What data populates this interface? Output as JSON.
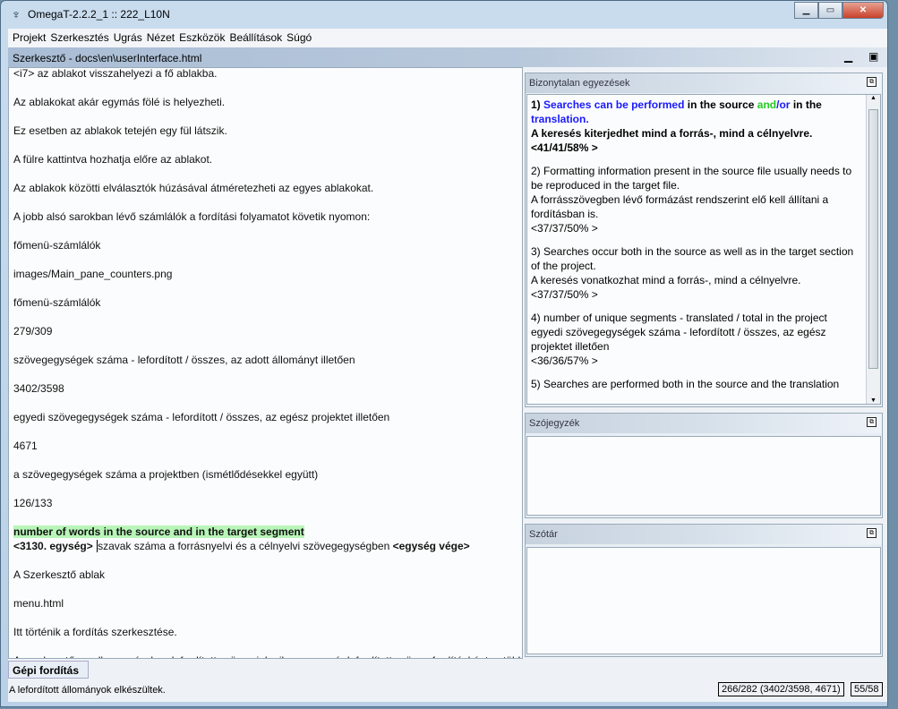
{
  "window": {
    "title": "OmegaT-2.2.2_1 :: 222_L10N",
    "controls": [
      "minimize",
      "maximize",
      "close"
    ]
  },
  "menu": [
    {
      "label": "Projekt",
      "key": "P"
    },
    {
      "label": "Szerkesztés",
      "key": "S"
    },
    {
      "label": "Ugrás",
      "key": "U"
    },
    {
      "label": "Nézet",
      "key": "N"
    },
    {
      "label": "Eszközök",
      "key": ""
    },
    {
      "label": "Beállítások",
      "key": "B"
    },
    {
      "label": "Súgó",
      "key": "S"
    }
  ],
  "editor": {
    "title": "Szerkesztő - docs\\en\\userInterface.html",
    "lines": [
      "<i7> az ablakot visszahelyezi a fő ablakba.",
      "Az ablakokat akár egymás fölé is helyezheti.",
      "Ez esetben az ablakok tetején egy fül látszik.",
      "A fülre kattintva hozhatja előre az ablakot.",
      "Az ablakok közötti elválasztók húzásával átméretezheti az egyes ablakokat.",
      "A jobb alsó sarokban lévő számlálók a fordítási folyamatot követik nyomon:",
      "főmenü-számlálók",
      "images/Main_pane_counters.png",
      "főmenü-számlálók",
      "279/309",
      "szövegegységek száma -  lefordított / összes, az adott állományt illetően",
      "3402/3598",
      "egyedi szövegegységek száma -  lefordított / összes, az egész projektet illetően",
      "4671",
      "a szövegegységek száma a projektben (ismétlődésekkel együtt)",
      "126/133"
    ],
    "active_source": "number of words in the source and in the target segment",
    "active_start_tag": "<3130. egység>",
    "active_target": "szavak száma a forrásnyelvi és a célnyelvi szövegegységben",
    "active_end_tag": "<egység vége>",
    "after": [
      "A Szerkesztő ablak",
      "menu.html",
      "Itt történik a fordítás szerkesztése.",
      "A szerkesztőpanelben a részben lefordított szöveg jelenik meg; a már lefordított szöveg fordításként, a több"
    ]
  },
  "fuzzy": {
    "title": "Bizonytalan egyezések",
    "m1": {
      "num": "1)",
      "p1": "Searches can be performed",
      "p2": "in the source",
      "p3": "and",
      "p4": "/or",
      "p5": "in the",
      "p6": "translation.",
      "target": "A keresés kiterjedhet mind a forrás-, mind a célnyelvre.",
      "score": "<41/41/58%  >"
    },
    "m2": {
      "source": "2) Formatting information present in the source file usually needs to be reproduced in the target file.",
      "target": "A forrásszövegben lévő formázást rendszerint elő kell állítani a fordításban is.",
      "score": "<37/37/50%  >"
    },
    "m3": {
      "source": "3) Searches occur both in the source as well as in the target section of the project.",
      "target": "A keresés vonatkozhat mind a forrás-, mind a célnyelvre.",
      "score": "<37/37/50%  >"
    },
    "m4": {
      "source": "4) number of unique segments - translated / total in the project",
      "target": "egyedi szövegegységek száma -  lefordított / összes, az egész projektet illetően",
      "score": "<36/36/57%  >"
    },
    "m5": {
      "source": "5) Searches are performed both in the source and the translation"
    }
  },
  "glossary": {
    "title": "Szójegyzék"
  },
  "dictionary": {
    "title": "Szótár"
  },
  "tabs": {
    "machine_translation": "Gépi fordítás"
  },
  "status": {
    "message": "A lefordított állományok elkészültek.",
    "progress": "266/282 (3402/3598, 4671)",
    "chars": "55/58"
  }
}
